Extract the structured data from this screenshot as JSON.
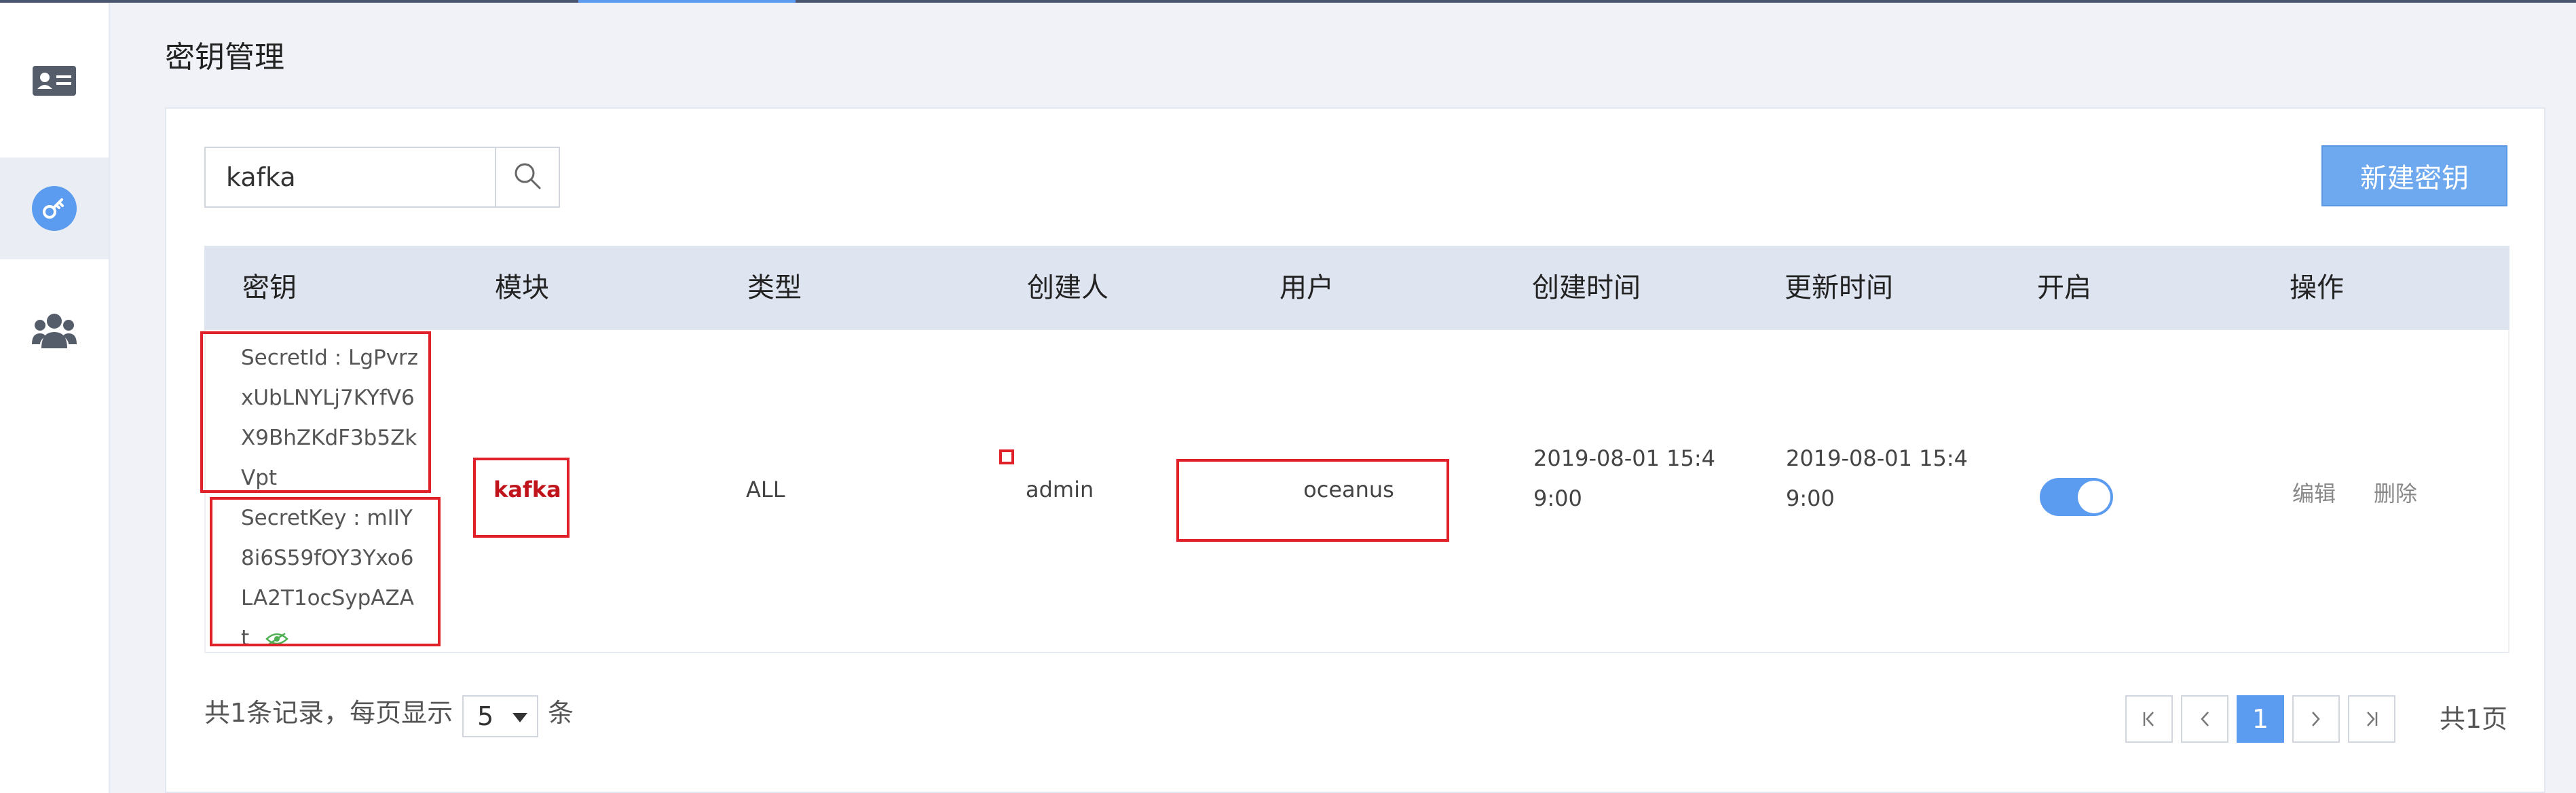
{
  "page": {
    "title": "密钥管理"
  },
  "sidebar": {
    "items": [
      {
        "name": "id-card-icon",
        "active": false
      },
      {
        "name": "key-icon",
        "active": true
      },
      {
        "name": "users-icon",
        "active": false
      }
    ]
  },
  "toolbar": {
    "search_value": "kafka",
    "new_key_label": "新建密钥"
  },
  "table": {
    "headers": [
      "密钥",
      "模块",
      "类型",
      "创建人",
      "用户",
      "创建时间",
      "更新时间",
      "开启",
      "操作"
    ],
    "rows": [
      {
        "secret_id_lines": [
          "SecretId : LgPvrz",
          "xUbLNYLj7KYfV6",
          "X9BhZKdF3b5Zk",
          "Vpt"
        ],
        "secret_key_lines": [
          "SecretKey : mIIY",
          "8i6S59fOY3Yxo6",
          "LA2T1ocSypAZA",
          "t"
        ],
        "module": "kafka",
        "type": "ALL",
        "creator": "admin",
        "user": "oceanus",
        "created_lines": [
          "2019-08-01 15:4",
          "9:00"
        ],
        "updated_lines": [
          "2019-08-01 15:4",
          "9:00"
        ],
        "enabled": true,
        "actions": {
          "edit": "编辑",
          "delete": "删除"
        }
      }
    ]
  },
  "footer": {
    "records_text": "共1条记录，每页显示",
    "page_size": "5",
    "unit": "条",
    "current_page": "1",
    "total_pages_text": "共1页"
  },
  "colors": {
    "accent": "#5b9cf0",
    "highlight_box": "#e0212a",
    "module_text": "#c0141c",
    "eye_icon": "#4caf50"
  }
}
